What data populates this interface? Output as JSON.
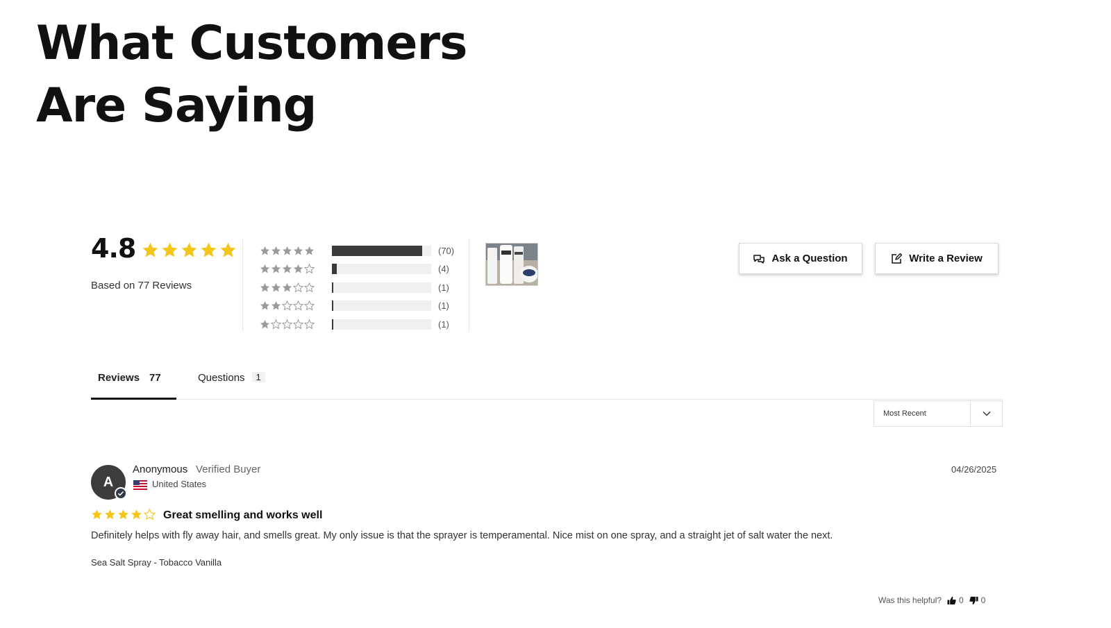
{
  "headline": {
    "line1": "What Customers",
    "line2": "Are Saying"
  },
  "summary": {
    "average": "4.8",
    "average_stars": 5,
    "based_on": "Based on 77 Reviews",
    "histogram": [
      {
        "stars": 5,
        "count_label": "(70)",
        "fraction": 0.909
      },
      {
        "stars": 4,
        "count_label": "(4)",
        "fraction": 0.052
      },
      {
        "stars": 3,
        "count_label": "(1)",
        "fraction": 0.013
      },
      {
        "stars": 2,
        "count_label": "(1)",
        "fraction": 0.013
      },
      {
        "stars": 1,
        "count_label": "(1)",
        "fraction": 0.013
      }
    ]
  },
  "actions": {
    "ask_label": "Ask a Question",
    "write_label": "Write a Review"
  },
  "tabs": {
    "reviews_label": "Reviews",
    "reviews_count": "77",
    "questions_label": "Questions",
    "questions_count": "1"
  },
  "sort": {
    "selected": "Most Recent"
  },
  "review": {
    "avatar_letter": "A",
    "author": "Anonymous",
    "verified": "Verified Buyer",
    "country": "United States",
    "date": "04/26/2025",
    "rating": 4,
    "title": "Great smelling and works well",
    "body": "Definitely helps with fly away hair, and smells great. My only issue is that the sprayer is temperamental. Nice mist on one spray, and a straight jet of salt water the next.",
    "product": "Sea Salt Spray - Tobacco Vanilla",
    "helpful_label": "Was this helpful?",
    "thumbs_up": "0",
    "thumbs_down": "0"
  },
  "colors": {
    "star_gold": "#f5c518",
    "star_gray": "#9a9a9a",
    "bar_fill": "#3a3a3a",
    "bar_track": "#efefef"
  },
  "icons": {
    "ask": "chat-bubbles-icon",
    "write": "edit-icon",
    "chevron": "chevron-down-icon",
    "up": "thumbs-up-icon",
    "down": "thumbs-down-icon"
  }
}
